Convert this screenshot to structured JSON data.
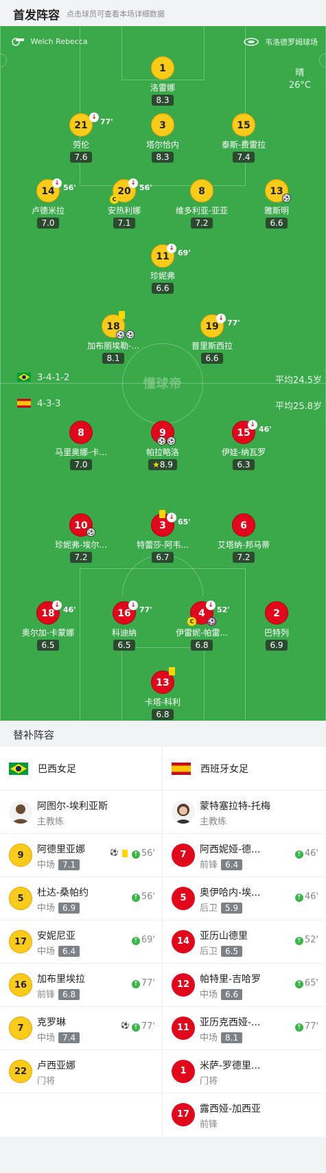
{
  "header": {
    "title": "首发阵容",
    "subtitle": "点击球员可查看本场详细数据"
  },
  "venue": {
    "referee": "Welch Rebecca",
    "stadium": "韦洛德罗姆球场"
  },
  "weather": {
    "condition": "晴",
    "temp": "26°C"
  },
  "home": {
    "formation": "3-4-1-2",
    "avg_age": "平均24.5岁",
    "name": "巴西女足"
  },
  "away": {
    "formation": "4-3-3",
    "avg_age": "平均25.8岁",
    "name": "西班牙女足"
  },
  "logo_text": "懂球帝",
  "home_players": [
    {
      "num": "1",
      "name": "洛雷娜",
      "rating": "8.3"
    },
    {
      "num": "21",
      "name": "劳伦",
      "rating": "7.6",
      "sub": "77'"
    },
    {
      "num": "3",
      "name": "塔尔恰内",
      "rating": "8.3"
    },
    {
      "num": "15",
      "name": "泰斯-费雷拉",
      "rating": "7.4"
    },
    {
      "num": "14",
      "name": "卢德米拉",
      "rating": "7.0",
      "sub": "56'"
    },
    {
      "num": "20",
      "name": "安热利娜",
      "rating": "7.1",
      "sub": "56'",
      "captain": "C"
    },
    {
      "num": "8",
      "name": "维多利亚-亚亚",
      "rating": "7.2"
    },
    {
      "num": "13",
      "name": "雅斯明",
      "rating": "6.6"
    },
    {
      "num": "11",
      "name": "珍妮弗",
      "rating": "6.6",
      "sub": "69'"
    },
    {
      "num": "18",
      "name": "加布丽埃勒-...",
      "rating": "8.1"
    },
    {
      "num": "19",
      "name": "普里斯西拉",
      "rating": "6.6",
      "sub": "77'"
    }
  ],
  "away_players": [
    {
      "num": "8",
      "name": "马里奥娜-卡...",
      "rating": "7.0"
    },
    {
      "num": "9",
      "name": "帕拉略洛",
      "rating": "8.9"
    },
    {
      "num": "15",
      "name": "伊娃-纳瓦罗",
      "rating": "6.3",
      "sub": "46'"
    },
    {
      "num": "10",
      "name": "珍妮弗-埃尔...",
      "rating": "7.2"
    },
    {
      "num": "3",
      "name": "特蕾莎-阿韦...",
      "rating": "6.7",
      "sub": "65'"
    },
    {
      "num": "6",
      "name": "艾塔纳-邦马蒂",
      "rating": "7.2"
    },
    {
      "num": "18",
      "name": "奥尔加-卡蒙娜",
      "rating": "6.5",
      "sub": "46'"
    },
    {
      "num": "16",
      "name": "科迪纳",
      "rating": "6.5",
      "sub": "77'"
    },
    {
      "num": "4",
      "name": "伊雷妮-帕雷...",
      "rating": "6.8",
      "sub": "52'",
      "captain": "C"
    },
    {
      "num": "2",
      "name": "巴特列",
      "rating": "6.9"
    },
    {
      "num": "13",
      "name": "卡塔-科利",
      "rating": "6.8"
    }
  ],
  "subs": {
    "title": "替补阵容",
    "home": [
      {
        "num": "",
        "name": "阿图尔-埃利亚斯",
        "pos": "主教练",
        "rating": "",
        "min": ""
      },
      {
        "num": "9",
        "name": "阿德里亚娜",
        "pos": "中场",
        "rating": "7.1",
        "min": "56'"
      },
      {
        "num": "5",
        "name": "杜达-桑帕约",
        "pos": "中场",
        "rating": "6.9",
        "min": "56'"
      },
      {
        "num": "17",
        "name": "安妮尼亚",
        "pos": "中场",
        "rating": "6.4",
        "min": "69'"
      },
      {
        "num": "16",
        "name": "加布里埃拉",
        "pos": "前锋",
        "rating": "6.8",
        "min": "77'"
      },
      {
        "num": "7",
        "name": "克罗琳",
        "pos": "中场",
        "rating": "7.4",
        "min": "77'"
      },
      {
        "num": "22",
        "name": "卢西亚娜",
        "pos": "门将",
        "rating": "",
        "min": ""
      }
    ],
    "away": [
      {
        "num": "",
        "name": "蒙特塞拉特-托梅",
        "pos": "主教练",
        "rating": "",
        "min": ""
      },
      {
        "num": "7",
        "name": "阿西妮娅-德...",
        "pos": "前锋",
        "rating": "6.4",
        "min": "46'"
      },
      {
        "num": "5",
        "name": "奥伊哈内-埃...",
        "pos": "后卫",
        "rating": "5.9",
        "min": "46'"
      },
      {
        "num": "14",
        "name": "亚历山德里",
        "pos": "后卫",
        "rating": "6.5",
        "min": "52'"
      },
      {
        "num": "12",
        "name": "帕特里-吉哈罗",
        "pos": "中场",
        "rating": "6.6",
        "min": "65'"
      },
      {
        "num": "11",
        "name": "亚历克西娅-...",
        "pos": "中场",
        "rating": "8.1",
        "min": "77'"
      },
      {
        "num": "1",
        "name": "米萨-罗德里...",
        "pos": "门将",
        "rating": "",
        "min": ""
      },
      {
        "num": "17",
        "name": "露西娅-加西亚",
        "pos": "前锋",
        "rating": "",
        "min": ""
      }
    ]
  },
  "colors": {
    "pitch": "#3aa94a",
    "home": "#fbcb1a",
    "away": "#e1081c"
  }
}
